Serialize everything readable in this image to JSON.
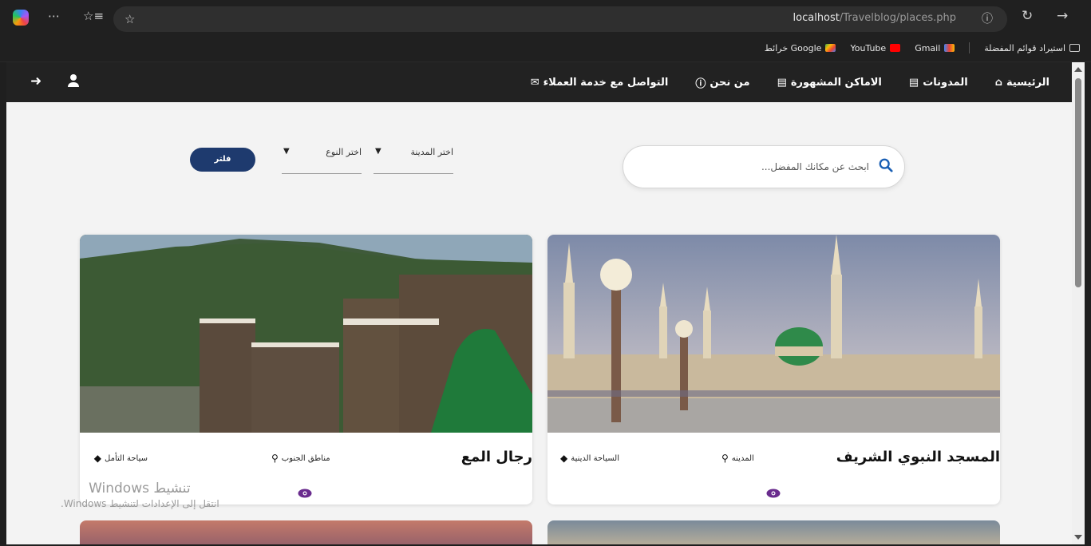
{
  "browser": {
    "url_host": "localhost",
    "url_path": "/Travelblog/places.php",
    "bookmarks": [
      {
        "label": "استيراد قوائم المفضلة",
        "icon": "import-favorites-icon"
      },
      {
        "label": "Gmail",
        "icon": "gmail-icon"
      },
      {
        "label": "YouTube",
        "icon": "youtube-icon"
      },
      {
        "label": "خرائط Google",
        "icon": "google-maps-icon"
      }
    ]
  },
  "navbar": {
    "links": [
      {
        "label": "الرئيسية",
        "icon": "home-icon"
      },
      {
        "label": "المدونات",
        "icon": "newspaper-icon"
      },
      {
        "label": "الاماكن المشهورة",
        "icon": "newspaper-icon"
      },
      {
        "label": "من نحن",
        "icon": "info-icon"
      },
      {
        "label": "التواصل مع خدمة العملاء",
        "icon": "envelope-icon"
      }
    ]
  },
  "search": {
    "placeholder": "ابحث عن مكانك المفضل..."
  },
  "filters": {
    "city_label": "اختر المدينة",
    "type_label": "اختر النوع",
    "button_label": "فلتر"
  },
  "cards": [
    {
      "title": "المسجد النبوي الشريف",
      "city": "المدينه",
      "category": "السياحة الدينية",
      "image": "prophets-mosque-photo"
    },
    {
      "title": "رجال المع",
      "city": "مناطق الجنوب",
      "category": "سياحة التأمل",
      "image": "rijal-almaa-village-photo"
    }
  ],
  "watermark": {
    "line1": "تنشيط Windows",
    "line2": "انتقل إلى الإعدادات لتنشيط Windows."
  }
}
